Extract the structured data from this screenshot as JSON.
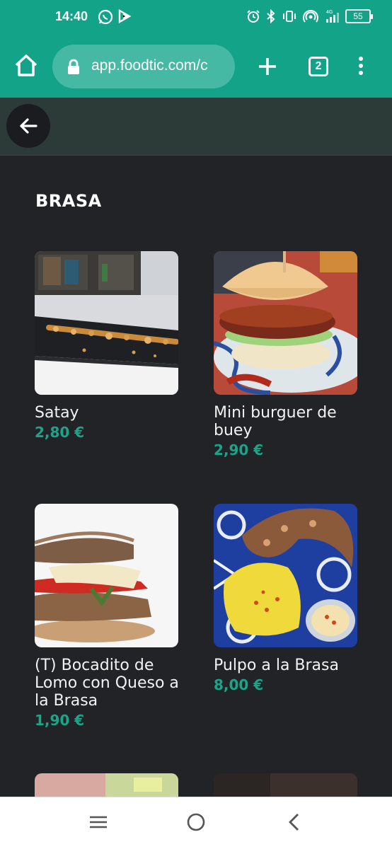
{
  "status_bar": {
    "time": "14:40",
    "battery": "55",
    "network": "4G"
  },
  "browser": {
    "url": "app.foodtic.com/c",
    "tab_count": "2"
  },
  "section": {
    "title": "BRASA"
  },
  "products": [
    {
      "name": "Satay",
      "price": "2,80 €",
      "image": "satay skewer photo"
    },
    {
      "name": "Mini burguer de buey",
      "price": "2,90 €",
      "image": "mini burger photo"
    },
    {
      "name": "(T) Bocadito de Lomo con Queso a la Brasa",
      "price": "1,90 €",
      "image": "sandwich photo"
    },
    {
      "name": "Pulpo a la Brasa",
      "price": "8,00 €",
      "image": "grilled octopus photo"
    }
  ],
  "colors": {
    "accent": "#12a389",
    "price": "#1aa58a",
    "background": "#222326"
  }
}
